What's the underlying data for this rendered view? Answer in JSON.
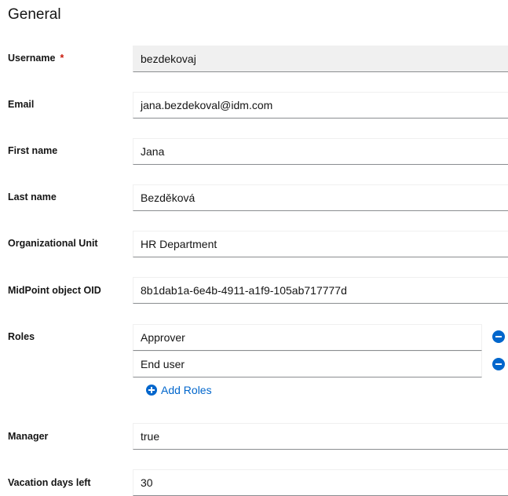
{
  "section": {
    "title": "General"
  },
  "fields": {
    "username": {
      "label": "Username",
      "required_mark": "*",
      "value": "bezdekovaj"
    },
    "email": {
      "label": "Email",
      "value": "jana.bezdekoval@idm.com"
    },
    "first_name": {
      "label": "First name",
      "value": "Jana"
    },
    "last_name": {
      "label": "Last name",
      "value": "Bezděková"
    },
    "org_unit": {
      "label": "Organizational Unit",
      "value": "HR Department"
    },
    "oid": {
      "label": "MidPoint object OID",
      "value": "8b1dab1a-6e4b-4911-a1f9-105ab717777d"
    },
    "roles": {
      "label": "Roles",
      "items": [
        {
          "value": "Approver"
        },
        {
          "value": "End user"
        }
      ],
      "add_label": "Add Roles"
    },
    "manager": {
      "label": "Manager",
      "value": "true"
    },
    "vacation": {
      "label": "Vacation days left",
      "value": "30"
    }
  },
  "colors": {
    "accent": "#0066cc",
    "required": "#c9190b",
    "readonly_bg": "#f0f0f0"
  },
  "icons": {
    "remove": "minus-circle-icon",
    "add": "plus-circle-icon"
  }
}
